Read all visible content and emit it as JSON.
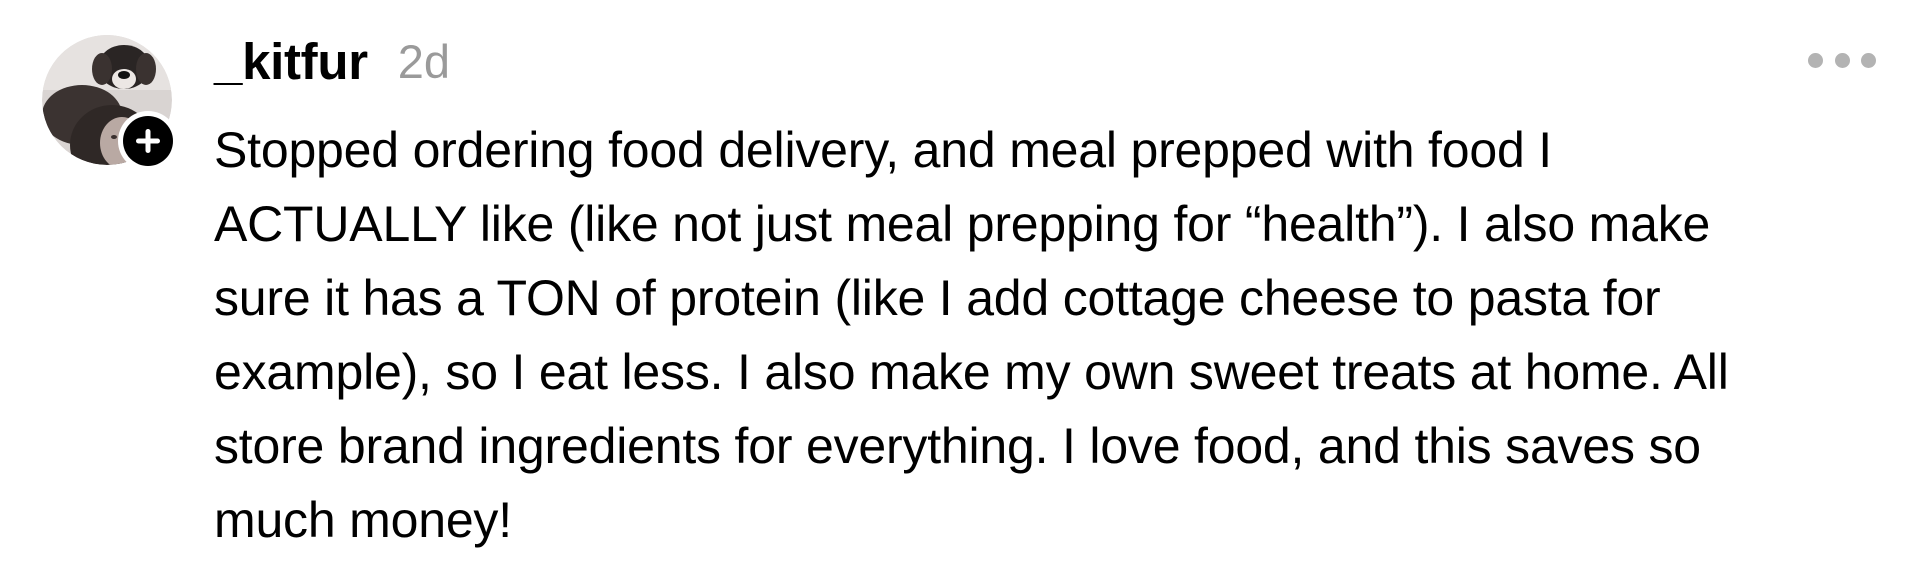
{
  "post": {
    "username": "_kitfur",
    "timestamp": "2d",
    "body": "Stopped ordering food delivery, and meal prepped with food I\nACTUALLY like (like not just meal prepping for “health”). I also make\nsure it has a TON of protein (like I add cottage cheese to pasta for\nexample), so I eat less. I also make my own sweet treats at home. All\nstore brand ingredients for everything. I love food, and this saves so\nmuch money!"
  },
  "icons": {
    "follow": "plus-icon",
    "more": "more-horizontal-icon"
  },
  "colors": {
    "text": "#000000",
    "timestamp": "#9a9a9a",
    "more_dots": "#b3b3b3",
    "badge": "#000000"
  }
}
